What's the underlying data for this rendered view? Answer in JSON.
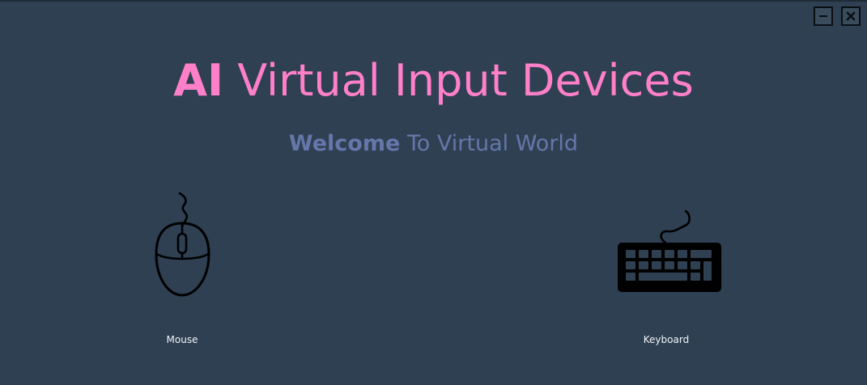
{
  "window": {
    "controls": [
      {
        "name": "minimize",
        "icon": "minimize-icon"
      },
      {
        "name": "close",
        "icon": "close-icon"
      }
    ]
  },
  "header": {
    "title_strong": "AI",
    "title_rest": " Virtual Input Devices",
    "subtitle_strong": "Welcome",
    "subtitle_rest": " To Virtual World"
  },
  "devices": [
    {
      "label": "Mouse",
      "icon": "mouse-icon"
    },
    {
      "label": "Keyboard",
      "icon": "keyboard-icon"
    }
  ],
  "colors": {
    "background": "#2e4052",
    "title": "#ff80c8",
    "subtitle": "#6577aa",
    "label": "#f2f4f7",
    "icon": "#000000"
  }
}
